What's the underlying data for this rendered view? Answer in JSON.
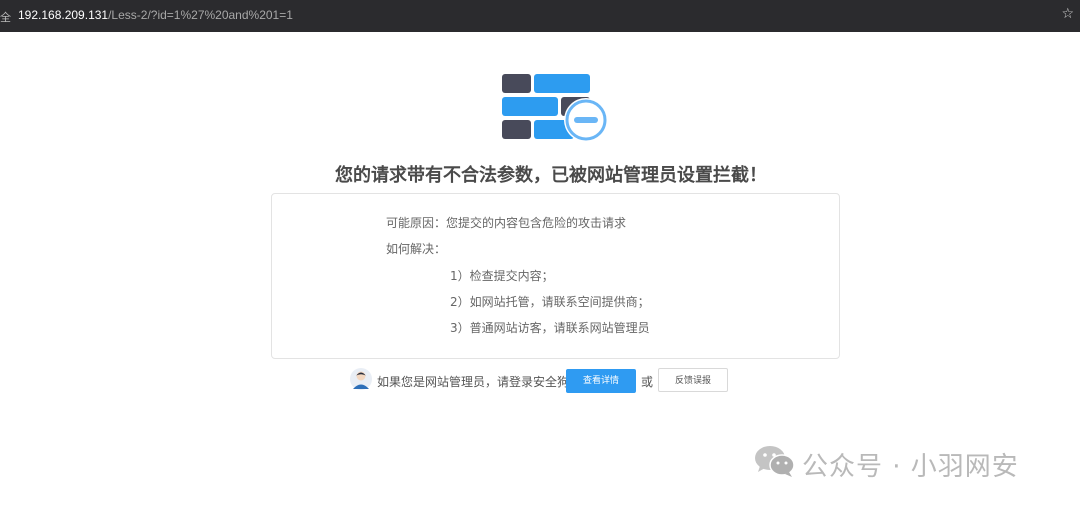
{
  "address_bar": {
    "security_label": "全",
    "url_host": "192.168.209.131",
    "url_path": "/Less-2/?id=1%27%20and%201=1",
    "bookmark_icon": "star-icon"
  },
  "logo": {
    "icon": "firewall-block-icon",
    "colors": {
      "brick_dark": "#484a5a",
      "brick_blue": "#2d9cf0",
      "badge_blue": "#6ab6f6"
    }
  },
  "title": "您的请求带有不合法参数，已被网站管理员设置拦截！",
  "info": {
    "reason": "可能原因：您提交的内容包含危险的攻击请求",
    "how_to": "如何解决：",
    "steps": [
      "1）检查提交内容；",
      "2）如网站托管，请联系空间提供商；",
      "3）普通网站访客，请联系网站管理员"
    ]
  },
  "footer": {
    "admin_text": "如果您是网站管理员，请登录安全狗",
    "detail_button": "查看详情",
    "or_text": "或",
    "report_button": "反馈误报",
    "avatar_icon": "admin-avatar-icon"
  },
  "watermark": {
    "icon": "wechat-icon",
    "text": "公众号 · 小羽网安"
  }
}
